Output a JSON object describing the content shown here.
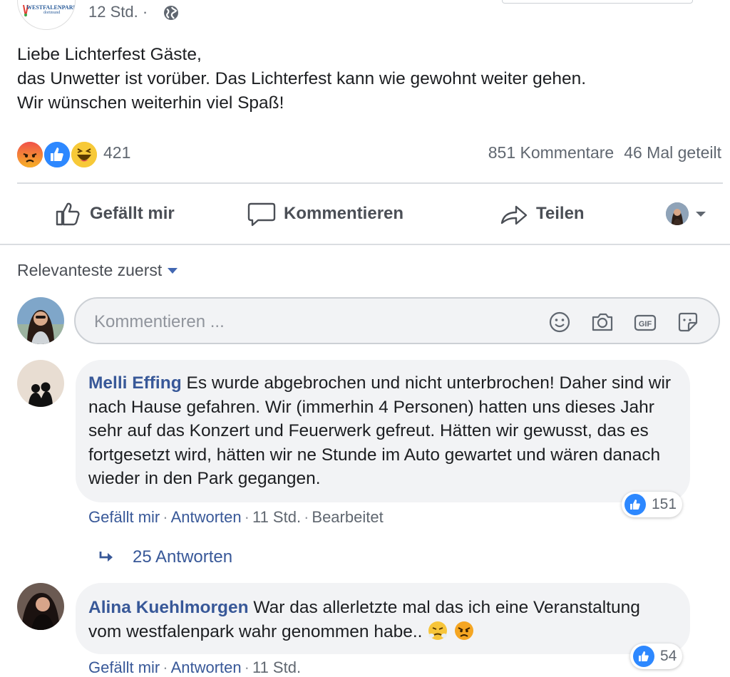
{
  "post": {
    "time": "12 Std.",
    "time_separator": "·",
    "page_logo": {
      "title": "WESTFALENPARK",
      "subtitle": "dortmund"
    },
    "text": "Liebe Lichterfest Gäste,\ndas Unwetter ist vorüber. Das Lichterfest kann wie gewohnt weiter gehen.\nWir wünschen weiterhin viel Spaß!",
    "reactions_count": "421",
    "comments_count": "851 Kommentare",
    "shares_count": "46 Mal geteilt"
  },
  "actions": {
    "like": "Gefällt mir",
    "comment": "Kommentieren",
    "share": "Teilen"
  },
  "sort": {
    "label": "Relevanteste zuerst"
  },
  "composer": {
    "placeholder": "Kommentieren ..."
  },
  "comments": [
    {
      "author": "Melli Effing",
      "text": "Es wurde abgebrochen und nicht unterbrochen! Daher sind wir nach Hause gefahren. Wir (immerhin 4 Personen) hatten uns dieses Jahr sehr auf das Konzert und Feuerwerk gefreut. Hätten wir gewusst, das es fortgesetzt wird, hätten wir ne Stunde im Auto gewartet und wären danach wieder in den Park gegangen.",
      "like_label": "Gefällt mir",
      "reply_label": "Antworten",
      "time": "11 Std.",
      "edited": "Bearbeitet",
      "likes": "151",
      "replies": "25 Antworten"
    },
    {
      "author": "Alina Kuehlmorgen",
      "text": "War das allerletzte mal das ich eine Veranstaltung vom westfalenpark wahr genommen habe..",
      "like_label": "Gefällt mir",
      "reply_label": "Antworten",
      "time": "11 Std.",
      "likes": "54"
    }
  ],
  "colors": {
    "link": "#385898",
    "like_blue": "#2d88ff",
    "text_secondary": "#606770",
    "bubble_bg": "#f2f3f5"
  }
}
